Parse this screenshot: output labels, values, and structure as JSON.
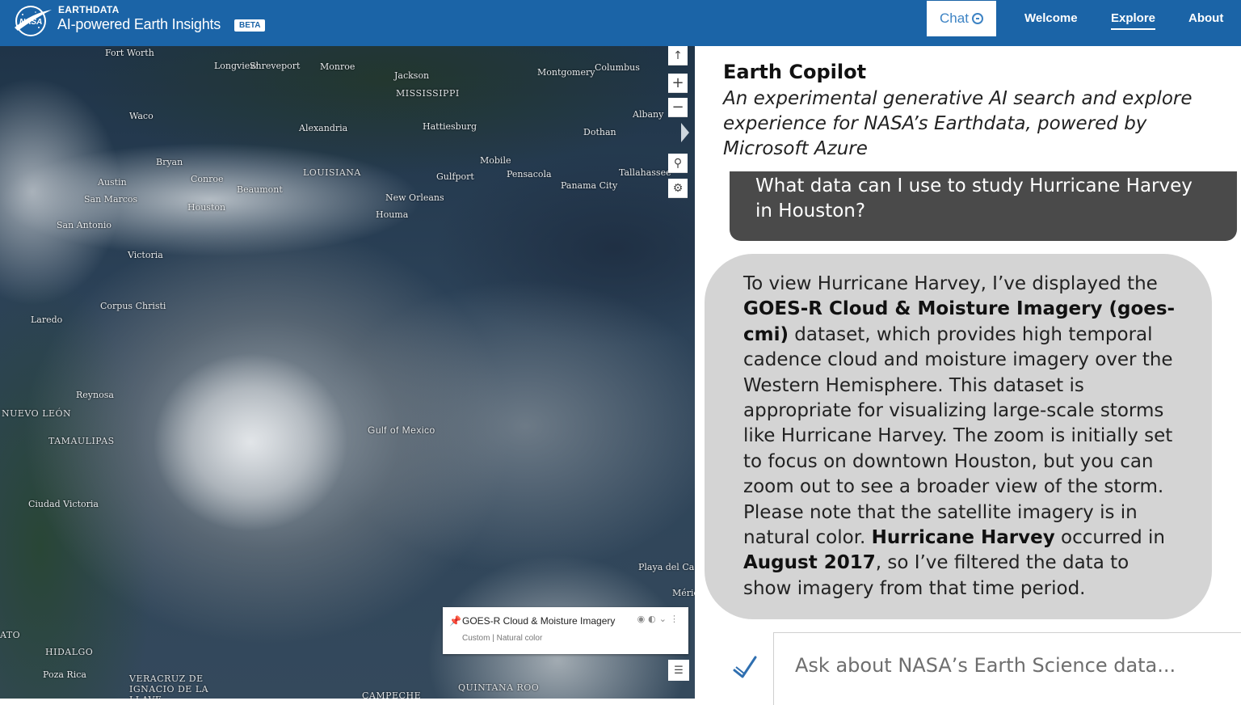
{
  "header": {
    "logo_text": "NASA",
    "brand_small": "EARTHDATA",
    "brand_title": "AI-powered Earth Insights",
    "beta_badge": "BETA",
    "nav": {
      "chat": "Chat",
      "welcome": "Welcome",
      "explore": "Explore",
      "about": "About"
    },
    "accent_color": "#1b64a7"
  },
  "map": {
    "labels": [
      "Fort Worth",
      "Longview",
      "Shreveport",
      "Monroe",
      "Jackson",
      "Montgomery",
      "Columbus",
      "MISSISSIPPI",
      "Albany",
      "Waco",
      "Alexandria",
      "Hattiesburg",
      "Dothan",
      "Bryan",
      "LOUISIANA",
      "Mobile",
      "Pensacola",
      "Gulfport",
      "Tallahassee",
      "Panama City",
      "Austin",
      "Conroe",
      "Beaumont",
      "New Orleans",
      "San Marcos",
      "Houma",
      "Houston",
      "San Antonio",
      "Victoria",
      "Corpus Christi",
      "Laredo",
      "Reynosa",
      "NUEVO LEÓN",
      "Gulf of Mexico",
      "TAMAULIPAS",
      "Ciudad Victoria",
      "Playa del Ca",
      "Mérida",
      "ATO",
      "HIDALGO",
      "Poza Rica",
      "VERACRUZ DE IGNACIO DE LA LLAVE",
      "QUINTANA ROO",
      "CAMPECHE"
    ],
    "toolbar_icons": [
      "compass-icon",
      "zoom-in-icon",
      "zoom-out-icon",
      "search-icon",
      "settings-icon"
    ],
    "layer": {
      "name": "GOES-R Cloud & Moisture Imagery",
      "subtitle": "Custom | Natural color",
      "controls": [
        "eye-icon",
        "opacity-icon",
        "chevron-down-icon",
        "more-icon"
      ]
    }
  },
  "chat": {
    "title": "Earth Copilot",
    "subtitle": "An experimental generative AI search and explore experience for NASA’s Earthdata, powered by Microsoft Azure",
    "user_message": "What data can I use to study Hurricane Harvey in Houston?",
    "assistant_segments": [
      {
        "text": "To view Hurricane Harvey, I’ve displayed the ",
        "bold": false
      },
      {
        "text": "GOES-R Cloud & Moisture Imagery (goes-cmi)",
        "bold": true
      },
      {
        "text": " dataset, which provides high temporal cadence cloud and moisture imagery over the Western Hemisphere. This dataset is appropriate for visualizing large-scale storms like Hurricane Harvey. The zoom is initially set to focus on downtown Houston, but you can zoom out to see a broader view of the storm. Please note that the satellite imagery is in natural color.  ",
        "bold": false
      },
      {
        "text": "Hurricane Harvey",
        "bold": true
      },
      {
        "text": " occurred in ",
        "bold": false
      },
      {
        "text": "August 2017",
        "bold": true
      },
      {
        "text": ", so I’ve filtered the data to show imagery from that time period.",
        "bold": false
      }
    ],
    "input_placeholder": "Ask about NASA’s Earth Science data..."
  }
}
